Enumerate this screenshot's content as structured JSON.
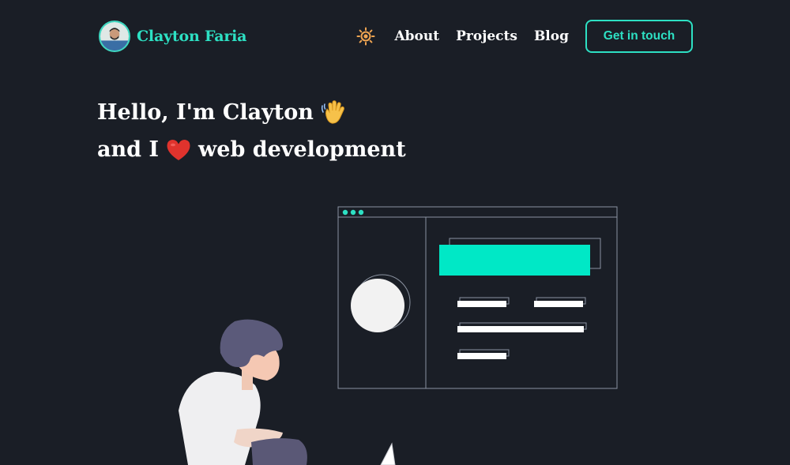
{
  "brand": {
    "name": "Clayton Faria",
    "avatar_icon": "avatar-photo-icon"
  },
  "nav": {
    "theme_toggle_icon": "sun-icon",
    "links": [
      "About",
      "Projects",
      "Blog"
    ],
    "cta_label": "Get in touch"
  },
  "hero": {
    "line1_text": "Hello, I'm Clayton",
    "line1_emoji": "waving-hand-icon",
    "line2_prefix": "and I",
    "line2_emoji": "red-heart-icon",
    "line2_suffix": "web development"
  },
  "colors": {
    "background": "#1a1e26",
    "accent": "#2de0c3",
    "text": "#ffffff",
    "sun": "#f0a552"
  }
}
